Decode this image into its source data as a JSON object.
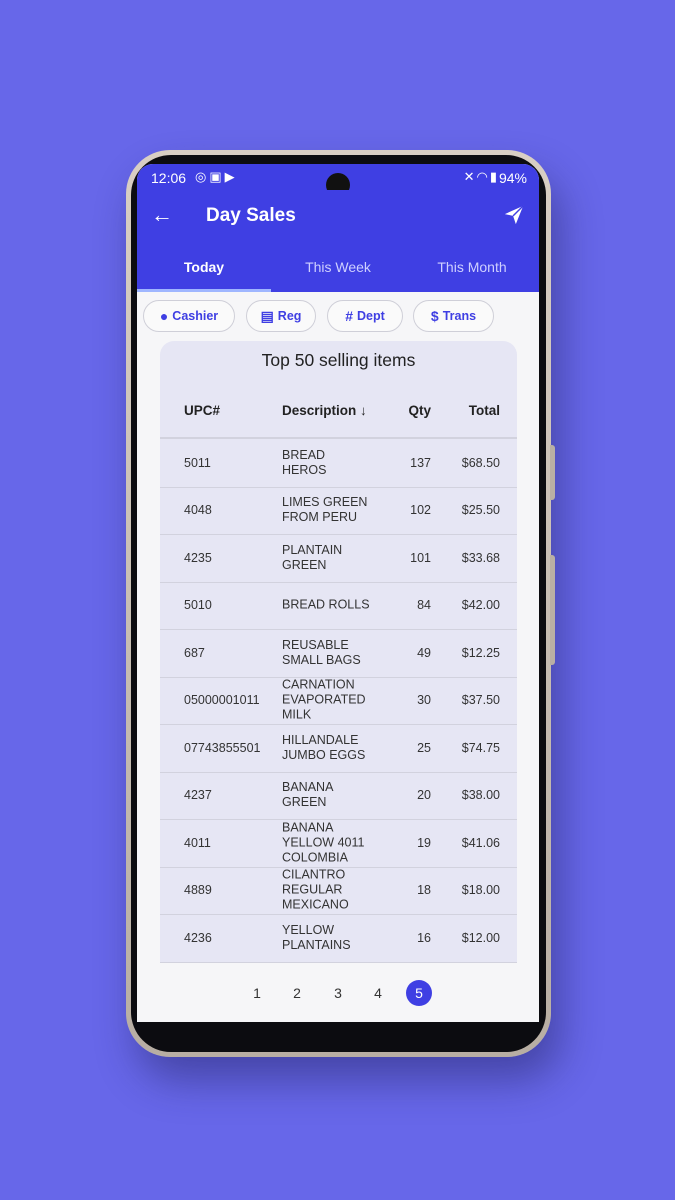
{
  "status_bar": {
    "time": "12:06",
    "battery": "94%",
    "icons_left": [
      "fingerprint-icon",
      "excel-icon",
      "app-icon"
    ],
    "icons_right": [
      "mute-icon",
      "wifi-icon",
      "signal-icon",
      "battery-icon"
    ]
  },
  "appbar": {
    "title": "Day Sales",
    "back_icon": "arrow-left-icon",
    "action_icon": "send-icon"
  },
  "tabs": [
    {
      "label": "Today",
      "active": true
    },
    {
      "label": "This Week",
      "active": false
    },
    {
      "label": "This Month",
      "active": false
    }
  ],
  "filters": [
    {
      "label": "Cashier",
      "icon": "person-icon"
    },
    {
      "label": "Reg",
      "icon": "register-icon"
    },
    {
      "label": "Dept",
      "icon": "hash-icon"
    },
    {
      "label": "Trans",
      "icon": "dollar-icon"
    }
  ],
  "card": {
    "title": "Top 50 selling items",
    "columns": [
      "UPC#",
      "Description",
      "Qty",
      "Total"
    ],
    "sort_icon": "arrow-down-icon",
    "rows": [
      {
        "upc": "5011",
        "description": "BREAD HEROS",
        "qty": "137",
        "total": "$68.50"
      },
      {
        "upc": "4048",
        "description": "LIMES GREEN FROM PERU",
        "qty": "102",
        "total": "$25.50"
      },
      {
        "upc": "4235",
        "description": "PLANTAIN GREEN",
        "qty": "101",
        "total": "$33.68"
      },
      {
        "upc": "5010",
        "description": "BREAD ROLLS",
        "qty": "84",
        "total": "$42.00"
      },
      {
        "upc": "687",
        "description": "REUSABLE SMALL BAGS",
        "qty": "49",
        "total": "$12.25"
      },
      {
        "upc": "05000001011",
        "description": "CARNATION EVAPORATED MILK",
        "qty": "30",
        "total": "$37.50"
      },
      {
        "upc": "07743855501",
        "description": "HILLANDALE JUMBO EGGS",
        "qty": "25",
        "total": "$74.75"
      },
      {
        "upc": "4237",
        "description": "BANANA GREEN",
        "qty": "20",
        "total": "$38.00"
      },
      {
        "upc": "4011",
        "description": "BANANA YELLOW 4011 COLOMBIA",
        "qty": "19",
        "total": "$41.06"
      },
      {
        "upc": "4889",
        "description": "CILANTRO REGULAR MEXICANO",
        "qty": "18",
        "total": "$18.00"
      },
      {
        "upc": "4236",
        "description": "YELLOW PLANTAINS",
        "qty": "16",
        "total": "$12.00"
      }
    ]
  },
  "pagination": {
    "pages": [
      "1",
      "2",
      "3",
      "4",
      "5"
    ],
    "current": "5"
  },
  "colors": {
    "accent": "#3f3fe3",
    "background": "#6767e9",
    "card": "#e6e6f4"
  }
}
